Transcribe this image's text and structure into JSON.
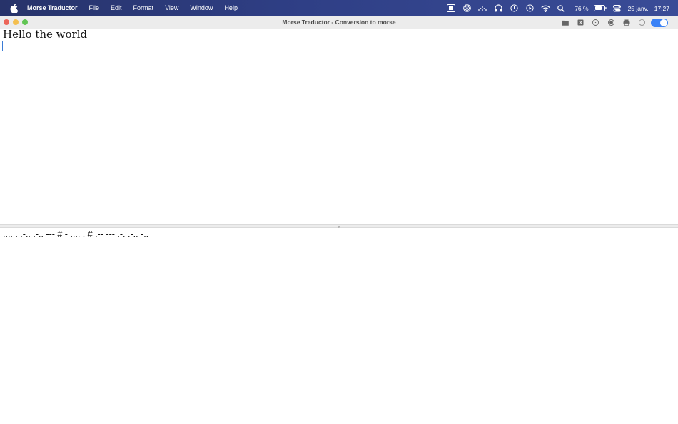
{
  "menubar": {
    "apple_icon": "apple-logo-icon",
    "app_name": "Morse Traductor",
    "menus": [
      "File",
      "Edit",
      "Format",
      "View",
      "Window",
      "Help"
    ],
    "tray_icons": [
      "screen-capture-icon",
      "fingerprint-icon",
      "dotted-wave-icon",
      "headphones-icon",
      "time-machine-icon",
      "play-circle-icon",
      "wifi-icon",
      "search-icon"
    ],
    "battery_percent": "76 %",
    "battery_level": 0.76,
    "control_center_icon": "control-center-icon",
    "date": "25 janv.",
    "time": "17:27"
  },
  "window": {
    "title": "Morse Traductor - Conversion to morse",
    "toolbar_icons": [
      "folder-icon",
      "clear-icon",
      "more-icon",
      "record-icon",
      "print-icon",
      "info-icon"
    ],
    "toggle_on": true,
    "accent_color": "#3b82f6"
  },
  "editor": {
    "input_text": "Hello the world",
    "output_text": ".... . .-.. .-.. --- # - .... . # .-- --- .-. .-.. -.."
  }
}
